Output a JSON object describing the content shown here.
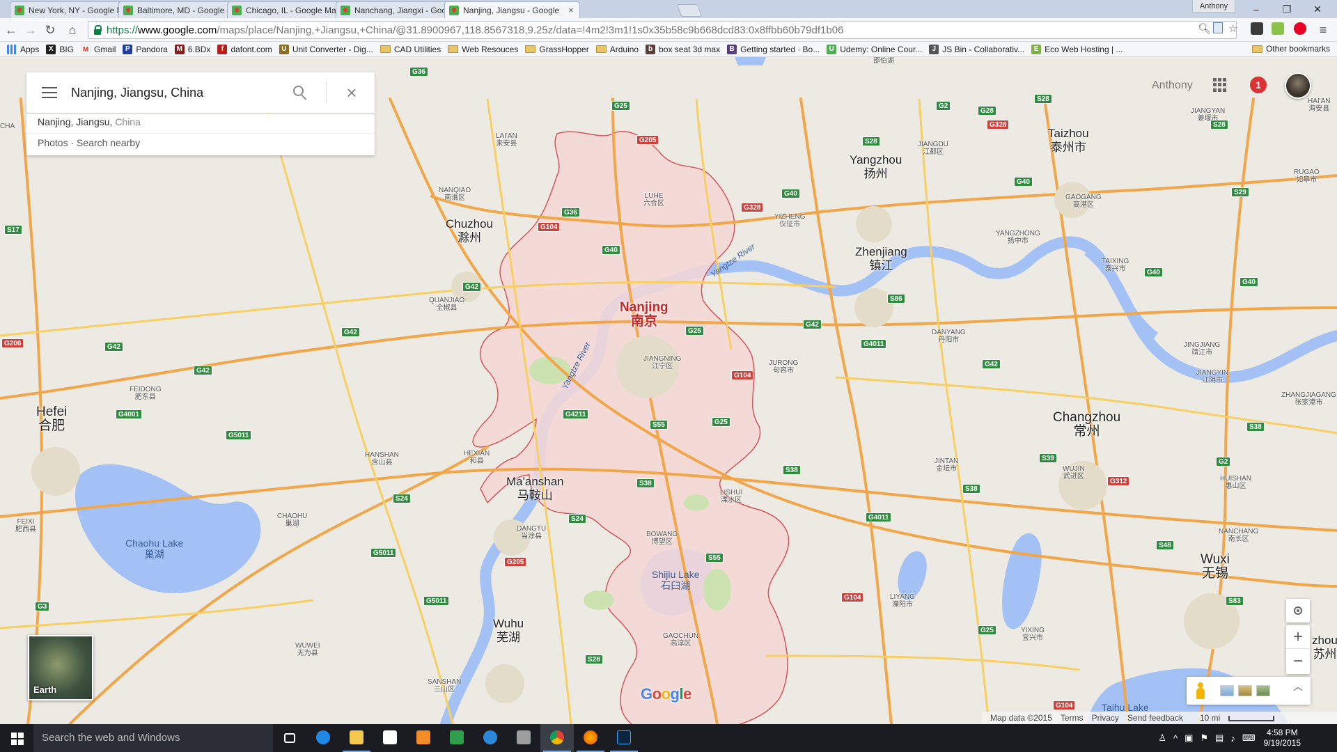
{
  "browser": {
    "tabs": [
      {
        "title": "New York, NY - Google M",
        "active": false
      },
      {
        "title": "Baltimore, MD - Google M",
        "active": false
      },
      {
        "title": "Chicago, IL - Google Map",
        "active": false
      },
      {
        "title": "Nanchang, Jiangxi - Goog",
        "active": false
      },
      {
        "title": "Nanjing, Jiangsu - Google",
        "active": true
      }
    ],
    "tab_close_glyph": "×",
    "profile_name": "Anthony",
    "window_controls": [
      "–",
      "❐",
      "✕"
    ],
    "url_scheme": "https://",
    "url_domain": "www.google.com",
    "url_path": "/maps/place/Nanjing,+Jiangsu,+China/@31.8900967,118.8567318,9.25z/data=!4m2!3m1!1s0x35b58c9b668dcd83:0x8ffbb60b79df1b06",
    "bookmarks": [
      {
        "label": "Apps",
        "type": "apps",
        "color": "#4285f4"
      },
      {
        "label": "BIG",
        "type": "site",
        "color": "#222222",
        "glyph": "X"
      },
      {
        "label": "Gmail",
        "type": "site",
        "color": "#d93025",
        "glyph": "M"
      },
      {
        "label": "Pandora",
        "type": "site",
        "color": "#224099",
        "glyph": "P"
      },
      {
        "label": "6.BDx",
        "type": "site",
        "color": "#8b1a1a",
        "glyph": "M"
      },
      {
        "label": "dafont.com",
        "type": "site",
        "color": "#b71c1c",
        "glyph": "f"
      },
      {
        "label": "Unit Converter - Dig...",
        "type": "site",
        "color": "#8a6d1e",
        "glyph": "U"
      },
      {
        "label": "CAD Utilities",
        "type": "folder"
      },
      {
        "label": "Web Resouces",
        "type": "folder"
      },
      {
        "label": "GrassHopper",
        "type": "folder"
      },
      {
        "label": "Arduino",
        "type": "folder"
      },
      {
        "label": "box seat 3d max",
        "type": "site",
        "color": "#5d4037",
        "glyph": "b"
      },
      {
        "label": "Getting started · Bo...",
        "type": "site",
        "color": "#563d7c",
        "glyph": "B"
      },
      {
        "label": "Udemy: Online Cour...",
        "type": "site",
        "color": "#4caf50",
        "glyph": "U"
      },
      {
        "label": "JS Bin - Collaborativ...",
        "type": "site",
        "color": "#555555",
        "glyph": "J"
      },
      {
        "label": "Eco Web Hosting | ...",
        "type": "site",
        "color": "#7cb342",
        "glyph": "E"
      }
    ],
    "other_bookmarks": "Other bookmarks"
  },
  "maps": {
    "search_value": "Nanjing, Jiangsu, China",
    "suggestion_main": "Nanjing, Jiangsu,",
    "suggestion_secondary": " China",
    "suggestion_actions": "Photos · Search nearby",
    "account_name": "Anthony",
    "notification_count": "1",
    "earth_label": "Earth",
    "google_logo": [
      "G",
      "o",
      "o",
      "g",
      "l",
      "e"
    ],
    "footer": {
      "map_data": "Map data ©2015",
      "terms": "Terms",
      "privacy": "Privacy",
      "feedback": "Send feedback",
      "scale": "10 mi"
    },
    "zoom_in": "+",
    "zoom_out": "−",
    "expand_glyph": "︿",
    "cities": [
      {
        "id": "nanjing",
        "en": "Nanjing",
        "zh": "南京"
      },
      {
        "id": "hefei",
        "en": "Hefei",
        "zh": "合肥"
      },
      {
        "id": "chuzhou",
        "en": "Chuzhou",
        "zh": "滁州"
      },
      {
        "id": "yangzhou",
        "en": "Yangzhou",
        "zh": "扬州"
      },
      {
        "id": "taizhou",
        "en": "Taizhou",
        "zh": "泰州市"
      },
      {
        "id": "zhenjiang",
        "en": "Zhenjiang",
        "zh": "镇江"
      },
      {
        "id": "changzhou",
        "en": "Changzhou",
        "zh": "常州"
      },
      {
        "id": "maanshan",
        "en": "Ma'anshan",
        "zh": "马鞍山"
      },
      {
        "id": "wuhu",
        "en": "Wuhu",
        "zh": "芜湖"
      },
      {
        "id": "wuxi",
        "en": "Wuxi",
        "zh": "无锡"
      }
    ],
    "towns": [
      {
        "id": "laian",
        "en": "LAI'AN",
        "zh": "来安县"
      },
      {
        "id": "nanqiao",
        "en": "NANQIAO",
        "zh": "南谯区"
      },
      {
        "id": "quanjiao",
        "en": "QUANJIAO",
        "zh": "全椒县"
      },
      {
        "id": "luhe",
        "en": "LUHE",
        "zh": "六合区"
      },
      {
        "id": "yizheng",
        "en": "YIZHENG",
        "zh": "仪征市"
      },
      {
        "id": "jiangdu",
        "en": "JIANGDU",
        "zh": "江都区"
      },
      {
        "id": "jiangyan",
        "en": "JIANGYAN",
        "zh": "姜堰市"
      },
      {
        "id": "gaogang",
        "en": "GAOGANG",
        "zh": "高港区"
      },
      {
        "id": "yangzhong",
        "en": "YANGZHONG",
        "zh": "扬中市"
      },
      {
        "id": "taixing",
        "en": "TAIXING",
        "zh": "泰兴市"
      },
      {
        "id": "rugao",
        "en": "RUGAO",
        "zh": "如皋市"
      },
      {
        "id": "haian",
        "en": "HAI'AN",
        "zh": "海安县"
      },
      {
        "id": "jingjiang",
        "en": "JINGJIANG",
        "zh": "靖江市"
      },
      {
        "id": "jiangyin",
        "en": "JIANGYIN",
        "zh": "江阴市"
      },
      {
        "id": "zhangjiagang",
        "en": "ZHANGJIAGANG",
        "zh": "张家港市"
      },
      {
        "id": "danyang",
        "en": "DANYANG",
        "zh": "丹阳市"
      },
      {
        "id": "jurong",
        "en": "JURONG",
        "zh": "句容市"
      },
      {
        "id": "jiangning",
        "en": "JIANGNING",
        "zh": "江宁区"
      },
      {
        "id": "jintan",
        "en": "JINTAN",
        "zh": "金坛市"
      },
      {
        "id": "wujin",
        "en": "WUJIN",
        "zh": "武进区"
      },
      {
        "id": "lishui",
        "en": "LISHUI",
        "zh": "溧水区"
      },
      {
        "id": "bowang",
        "en": "BOWANG",
        "zh": "博望区"
      },
      {
        "id": "liyang",
        "en": "LIYANG",
        "zh": "溧阳市"
      },
      {
        "id": "gaochun",
        "en": "GAOCHUN",
        "zh": "高淳区"
      },
      {
        "id": "yixing",
        "en": "YIXING",
        "zh": "宜兴市"
      },
      {
        "id": "huishan",
        "en": "HUISHAN",
        "zh": "惠山区"
      },
      {
        "id": "nanchang-wx",
        "en": "NANCHANG",
        "zh": "南长区"
      },
      {
        "id": "feidong",
        "en": "FEIDONG",
        "zh": "肥东县"
      },
      {
        "id": "feixi",
        "en": "FEIXI",
        "zh": "肥西县"
      },
      {
        "id": "hanshan",
        "en": "HANSHAN",
        "zh": "含山县"
      },
      {
        "id": "hexian",
        "en": "HEXIAN",
        "zh": "和县"
      },
      {
        "id": "chaohu",
        "en": "CHAOHU",
        "zh": "巢湖"
      },
      {
        "id": "dangtu",
        "en": "DANGTU",
        "zh": "当涂县"
      },
      {
        "id": "wuwei",
        "en": "WUWEI",
        "zh": "无为县"
      },
      {
        "id": "sanshan",
        "en": "SANSHAN",
        "zh": "三山区"
      }
    ],
    "lakes": [
      {
        "id": "chaohu-lake",
        "en": "Chaohu Lake",
        "zh": "巢湖"
      },
      {
        "id": "shijiu-lake",
        "en": "Shijiu Lake",
        "zh": "石臼湖"
      },
      {
        "id": "taihu-lake",
        "en": "Taihu Lake",
        "zh": ""
      }
    ],
    "rivers": [
      "Yangtze River",
      "Yangtze River"
    ],
    "corner_labels": [
      "CHA",
      "邵伯湖",
      "zhou",
      "苏州"
    ],
    "shields_green": [
      "G25",
      "G36",
      "G2",
      "G28",
      "S28",
      "S28",
      "S28",
      "G40",
      "G36",
      "G40",
      "S29",
      "S17",
      "G42",
      "G42",
      "G42",
      "G42",
      "S86",
      "G4011",
      "G42",
      "S38",
      "G40",
      "G25",
      "S55",
      "G4211",
      "G25",
      "G42",
      "G4001",
      "G5011",
      "S24",
      "S24",
      "S38",
      "S38",
      "G4011",
      "S38",
      "S39",
      "G2",
      "S48",
      "G5011",
      "G5011",
      "S55",
      "G25",
      "S28",
      "G3",
      "G40",
      "G40",
      "S83"
    ],
    "shields_red": [
      "G205",
      "G328",
      "G104",
      "G328",
      "G206",
      "G104",
      "G205",
      "G104",
      "G312",
      "G104"
    ]
  },
  "taskbar": {
    "search_placeholder": "Search the web and Windows",
    "time": "4:58 PM",
    "date": "9/19/2015"
  }
}
